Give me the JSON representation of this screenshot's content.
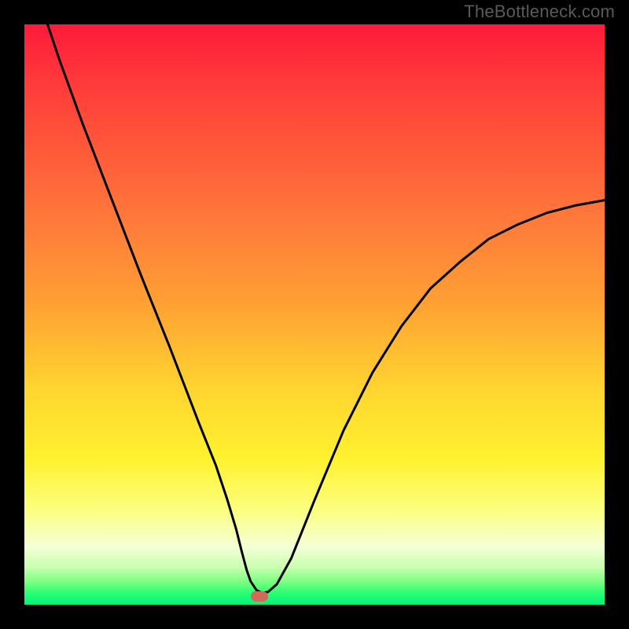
{
  "watermark": "TheBottleneck.com",
  "chart_data": {
    "type": "line",
    "title": "",
    "xlabel": "",
    "ylabel": "",
    "xlim": [
      0,
      100
    ],
    "ylim": [
      0,
      100
    ],
    "grid": false,
    "legend": false,
    "series": [
      {
        "name": "curve",
        "x": [
          4,
          6,
          10,
          15,
          20,
          25,
          30,
          33,
          35,
          36.5,
          37.5,
          38.3,
          39,
          40,
          41,
          42,
          43.5,
          46,
          50,
          55,
          60,
          65,
          70,
          75,
          80,
          85,
          90,
          95,
          100
        ],
        "y": [
          100,
          94,
          83,
          70,
          57,
          44.5,
          31.5,
          24,
          18,
          13,
          9,
          6,
          4,
          2.5,
          2,
          2.2,
          3.5,
          8,
          18,
          30,
          40,
          48,
          54.5,
          59,
          63,
          65.5,
          67.5,
          68.8,
          69.7
        ]
      }
    ],
    "marker": {
      "x": 40.5,
      "y": 1.5
    },
    "background_gradient_stops": [
      {
        "pos": 0,
        "color": "#ff1a3a"
      },
      {
        "pos": 10,
        "color": "#ff3a3a"
      },
      {
        "pos": 22,
        "color": "#ff5a3a"
      },
      {
        "pos": 34,
        "color": "#ff7a3a"
      },
      {
        "pos": 48,
        "color": "#ffa033"
      },
      {
        "pos": 63,
        "color": "#ffd52f"
      },
      {
        "pos": 75,
        "color": "#fff22f"
      },
      {
        "pos": 84,
        "color": "#fbff82"
      },
      {
        "pos": 90,
        "color": "#f5ffd7"
      },
      {
        "pos": 93.5,
        "color": "#c9ffb0"
      },
      {
        "pos": 96,
        "color": "#7dff82"
      },
      {
        "pos": 98,
        "color": "#28ff72"
      },
      {
        "pos": 100,
        "color": "#07f179"
      }
    ]
  }
}
